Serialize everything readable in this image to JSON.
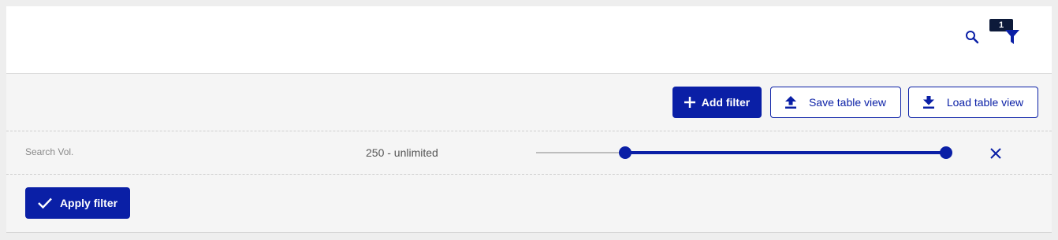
{
  "topbar": {
    "search_icon": "search-icon",
    "filter_icon": "funnel-icon",
    "filter_badge": "1"
  },
  "toolbar": {
    "add_filter_label": "Add filter",
    "save_view_label": "Save table view",
    "load_view_label": "Load table view"
  },
  "filter": {
    "label": "Search Vol.",
    "range_text": "250 - unlimited",
    "slider": {
      "low_fraction": 0.218,
      "high_fraction": 1.0
    }
  },
  "footer": {
    "apply_label": "Apply filter"
  },
  "colors": {
    "accent": "#0a1fa6",
    "badge": "#0d1a3a",
    "panel": "#f5f5f5"
  }
}
